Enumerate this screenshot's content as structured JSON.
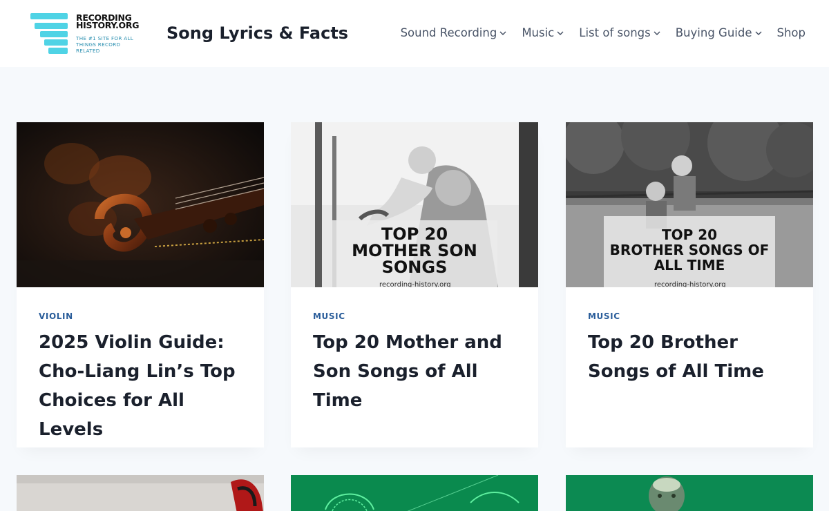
{
  "header": {
    "logo": {
      "name_line1": "RECORDING",
      "name_line2": "HISTORY.ORG",
      "tagline_line1": "THE #1 SITE FOR ALL",
      "tagline_line2": "THINGS RECORD",
      "tagline_line3": "RELATED"
    },
    "site_title": "Song Lyrics & Facts",
    "nav": [
      {
        "label": "Sound Recording",
        "has_dropdown": true
      },
      {
        "label": "Music",
        "has_dropdown": true
      },
      {
        "label": "List of songs",
        "has_dropdown": true
      },
      {
        "label": "Buying Guide",
        "has_dropdown": true
      },
      {
        "label": "Shop",
        "has_dropdown": false
      }
    ]
  },
  "posts": [
    {
      "category": "VIOLIN",
      "title": "2025 Violin Guide: Cho-Liang Lin’s Top Choices for All Levels"
    },
    {
      "category": "MUSIC",
      "title": "Top 20 Mother and Son Songs of All Time",
      "image_overlay_line1": "TOP 20",
      "image_overlay_line2": "MOTHER SON",
      "image_overlay_line3": "SONGS",
      "image_watermark": "recording-history.org"
    },
    {
      "category": "MUSIC",
      "title": "Top 20 Brother Songs of All Time",
      "image_overlay_line1": "TOP 20",
      "image_overlay_line2": "BROTHER SONGS OF",
      "image_overlay_line3": "ALL TIME",
      "image_watermark": "recording-history.org"
    }
  ],
  "colors": {
    "accent": "#4fd3e5",
    "category": "#2a5d9a",
    "background": "#f6f9fc",
    "green_thumb": "#0a8a4e"
  }
}
